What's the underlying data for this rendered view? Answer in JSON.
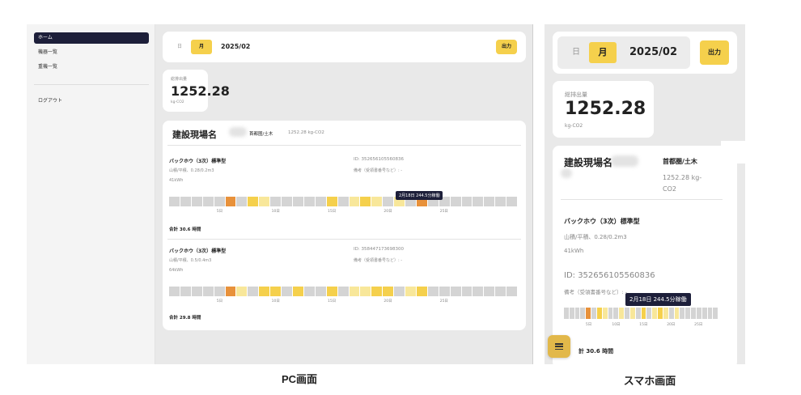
{
  "pc": {
    "sidebar": {
      "items": [
        {
          "label": "ホーム",
          "active": true
        },
        {
          "label": "機器一覧",
          "active": false
        },
        {
          "label": "重機一覧",
          "active": false
        }
      ],
      "logout": "ログアウト"
    },
    "toolbar": {
      "day": "日",
      "month": "月",
      "date": "2025/02",
      "output": "出力"
    },
    "total": {
      "label": "総排出量",
      "value": "1252.28",
      "unit": "kg-CO2"
    },
    "site": {
      "name": "建設現場名",
      "region": "首都圏/土木",
      "total": "1252.28 kg-CO2"
    },
    "machines": [
      {
        "name": "バックホウ（3次）標準型",
        "spec": "山積/平積、0.28/0.2m3",
        "power": "41kWh",
        "id": "ID: 352656105560836",
        "note": "備考（受領書番号など）: -",
        "total": "合計 30.6 時間",
        "tooltip": "2月18日 244.5分稼働",
        "days": [
          0,
          0,
          0,
          0,
          0,
          3,
          0,
          2,
          1,
          0,
          0,
          0,
          0,
          0,
          2,
          0,
          1,
          2,
          1,
          0,
          1,
          0,
          3,
          0,
          0,
          0,
          0,
          0,
          0,
          0,
          0
        ]
      },
      {
        "name": "バックホウ（3次）標準型",
        "spec": "山積/平積、0.5/0.4m3",
        "power": "64kWh",
        "id": "ID: 358447173698300",
        "note": "備考（受領書番号など）: -",
        "total": "合計 29.8 時間",
        "tooltip": "",
        "days": [
          0,
          0,
          0,
          0,
          0,
          3,
          1,
          0,
          2,
          2,
          0,
          2,
          0,
          0,
          2,
          0,
          1,
          1,
          2,
          2,
          0,
          1,
          2,
          0,
          0,
          0,
          0,
          0,
          0,
          0,
          0
        ]
      }
    ],
    "ticks": [
      "5日",
      "10日",
      "15日",
      "20日",
      "25日"
    ]
  },
  "sp": {
    "toolbar": {
      "day": "日",
      "month": "月",
      "date": "2025/02",
      "output": "出力"
    },
    "total": {
      "label": "総排出量",
      "value": "1252.28",
      "unit": "kg-CO2"
    },
    "site": {
      "name": "建設現場名",
      "region": "首都圏/土木",
      "total": "1252.28 kg-CO2"
    },
    "machine": {
      "name": "バックホウ（3次）標準型",
      "spec": "山積/平積、0.28/0.2m3",
      "power": "41kWh",
      "id": "ID: 352656105560836",
      "note": "備考（受領書番号など）: -",
      "tooltip": "2月18日 244.5分稼働",
      "total": "計 30.6 時間",
      "days": [
        0,
        0,
        0,
        0,
        3,
        0,
        2,
        1,
        0,
        0,
        1,
        0,
        1,
        0,
        2,
        0,
        1,
        2,
        1,
        0,
        1,
        0,
        0,
        0,
        0,
        0,
        0,
        0
      ]
    },
    "ticks": [
      "5日",
      "10日",
      "15日",
      "20日",
      "25日"
    ],
    "menu_icon": "menu-icon"
  },
  "captions": {
    "pc": "PC画面",
    "sp": "スマホ画面"
  },
  "colors": {
    "accent": "#f5d04c",
    "orange": "#e8913a",
    "yellow": "#f5d04c",
    "light_yellow": "#f8e79a",
    "empty": "#d4d4d4",
    "nav_active": "#1d1f3a"
  }
}
